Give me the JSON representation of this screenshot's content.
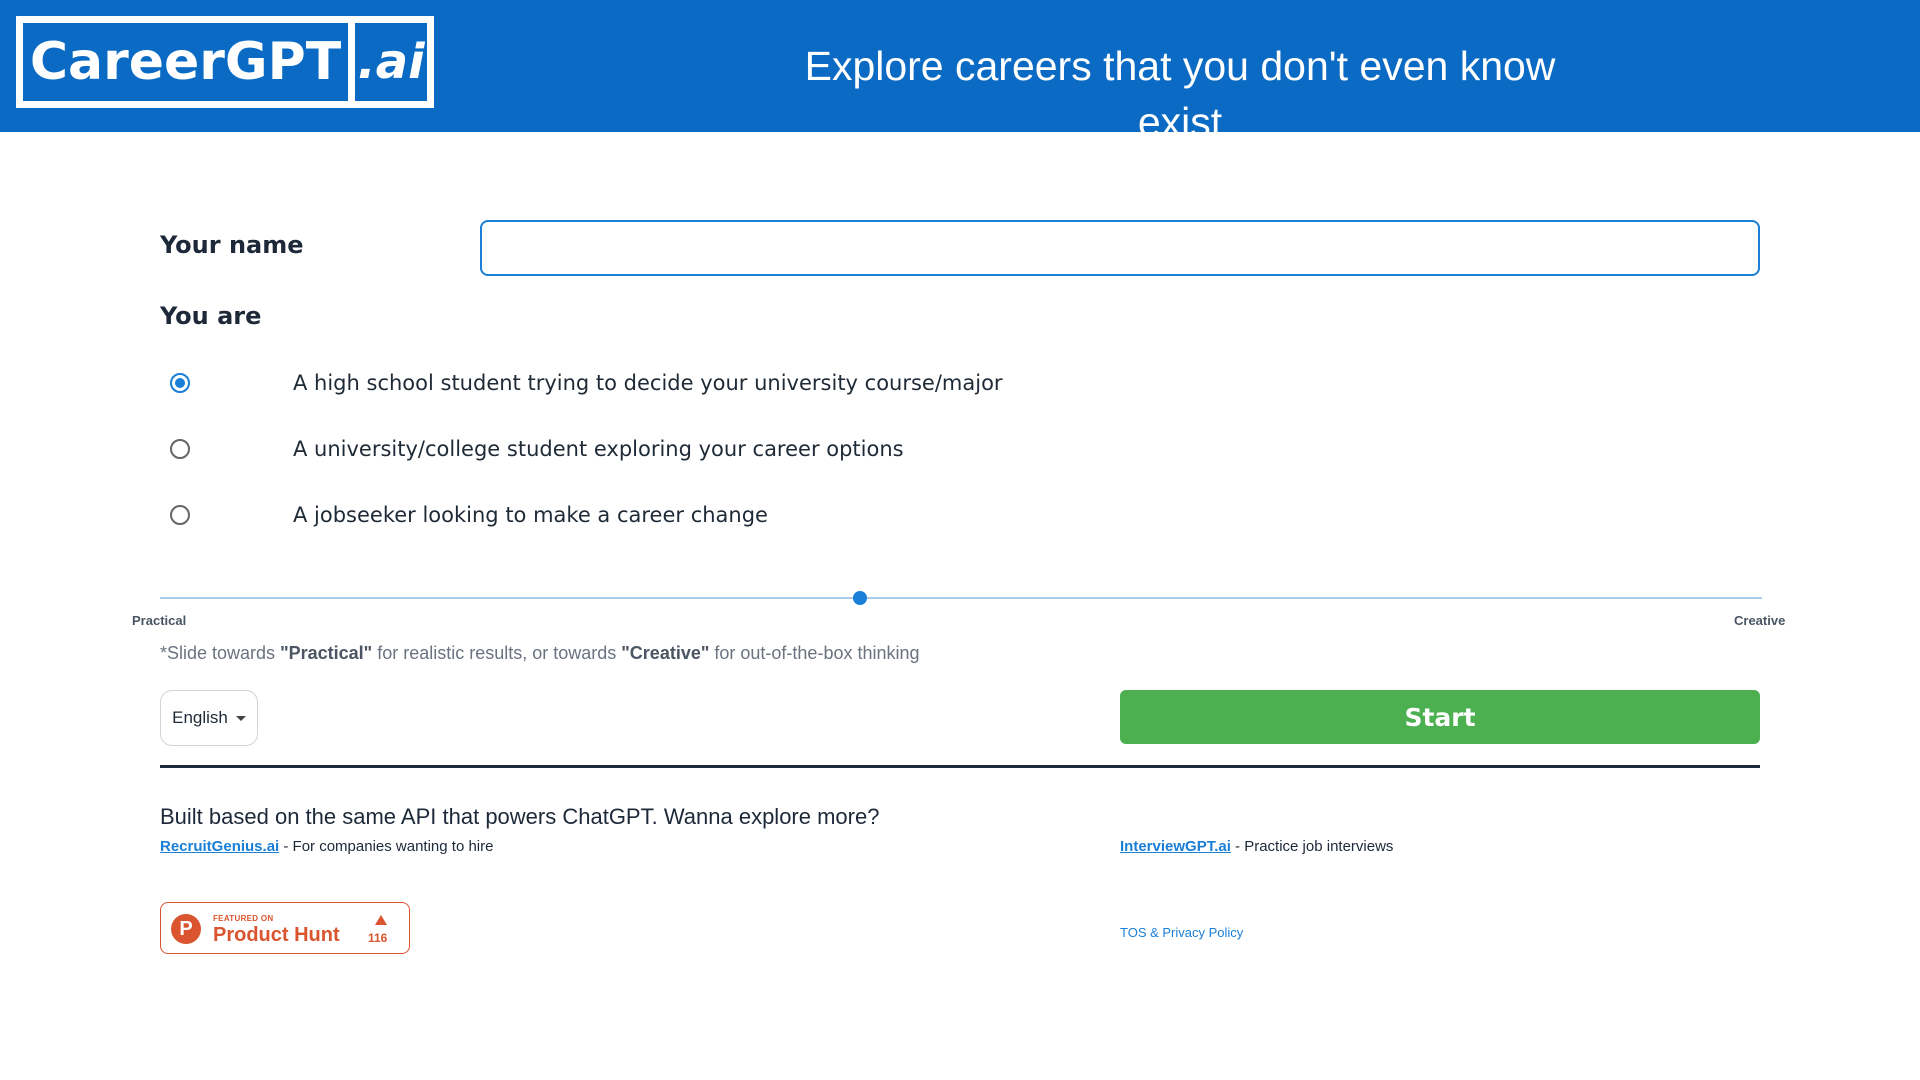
{
  "header": {
    "logo_main": "CareerGPT",
    "logo_ai": ".ai",
    "tagline": "Explore careers that you don't even know exist",
    "background_color": "#0b6bc4"
  },
  "form": {
    "name_label": "Your name",
    "name_value": "",
    "you_are_label": "You are",
    "options": [
      {
        "label": "A high school student trying to decide your university course/major",
        "selected": true
      },
      {
        "label": "A university/college student exploring your career options",
        "selected": false
      },
      {
        "label": "A jobseeker looking to make a career change",
        "selected": false
      }
    ],
    "slider": {
      "left_label": "Practical",
      "right_label": "Creative",
      "value_fraction": 0.44
    },
    "hint": {
      "part1": "*Slide towards ",
      "practical": "\"Practical\"",
      "part2": " for realistic results, or towards ",
      "creative": "\"Creative\"",
      "part3": " for out-of-the-box thinking"
    },
    "language": "English",
    "start_label": "Start",
    "start_color": "#4caf50"
  },
  "footer": {
    "built_text": "Built based on the same API that powers ChatGPT. Wanna explore more?",
    "link1": {
      "name": "RecruitGenius.ai",
      "desc": " - For companies wanting to hire"
    },
    "link2": {
      "name": "InterviewGPT.ai",
      "desc": " - Practice job interviews"
    },
    "product_hunt": {
      "icon": "producthunt-p-icon",
      "logo_letter": "P",
      "featured": "FEATURED ON",
      "name": "Product Hunt",
      "count": "116",
      "color": "#da552f"
    },
    "tos": "TOS & Privacy Policy"
  }
}
